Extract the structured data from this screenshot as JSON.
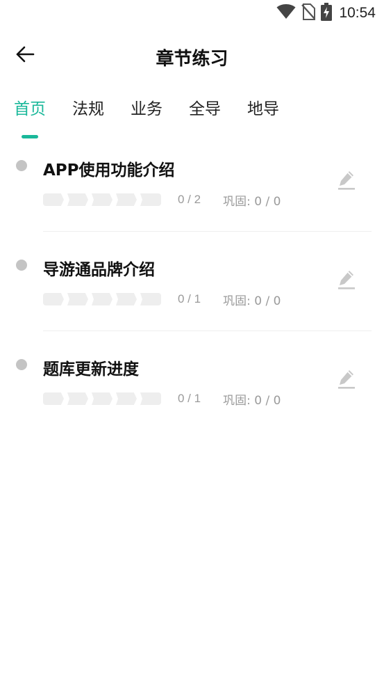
{
  "status_bar": {
    "time": "10:54",
    "icons": [
      "wifi-icon",
      "no-sim-icon",
      "battery-charging-icon"
    ]
  },
  "header": {
    "title": "章节练习",
    "back_icon": "back-arrow-icon"
  },
  "tabs": [
    {
      "label": "首页",
      "active": true
    },
    {
      "label": "法规",
      "active": false
    },
    {
      "label": "业务",
      "active": false
    },
    {
      "label": "全导",
      "active": false
    },
    {
      "label": "地导",
      "active": false
    }
  ],
  "chapters": [
    {
      "title": "APP使用功能介绍",
      "progress_text": "0 / 2",
      "review_text": "巩固: 0 / 0",
      "segments": 5
    },
    {
      "title": "导游通品牌介绍",
      "progress_text": "0 / 1",
      "review_text": "巩固: 0 / 0",
      "segments": 5
    },
    {
      "title": "题库更新进度",
      "progress_text": "0 / 1",
      "review_text": "巩固: 0 / 0",
      "segments": 5
    }
  ],
  "colors": {
    "accent": "#1ab89a",
    "text_primary": "#111111",
    "text_secondary": "#9a9a9a",
    "dot": "#c4c4c4",
    "segment": "#eeeeee",
    "divider": "#eeeeee",
    "edit_icon": "#c8c8c8"
  }
}
